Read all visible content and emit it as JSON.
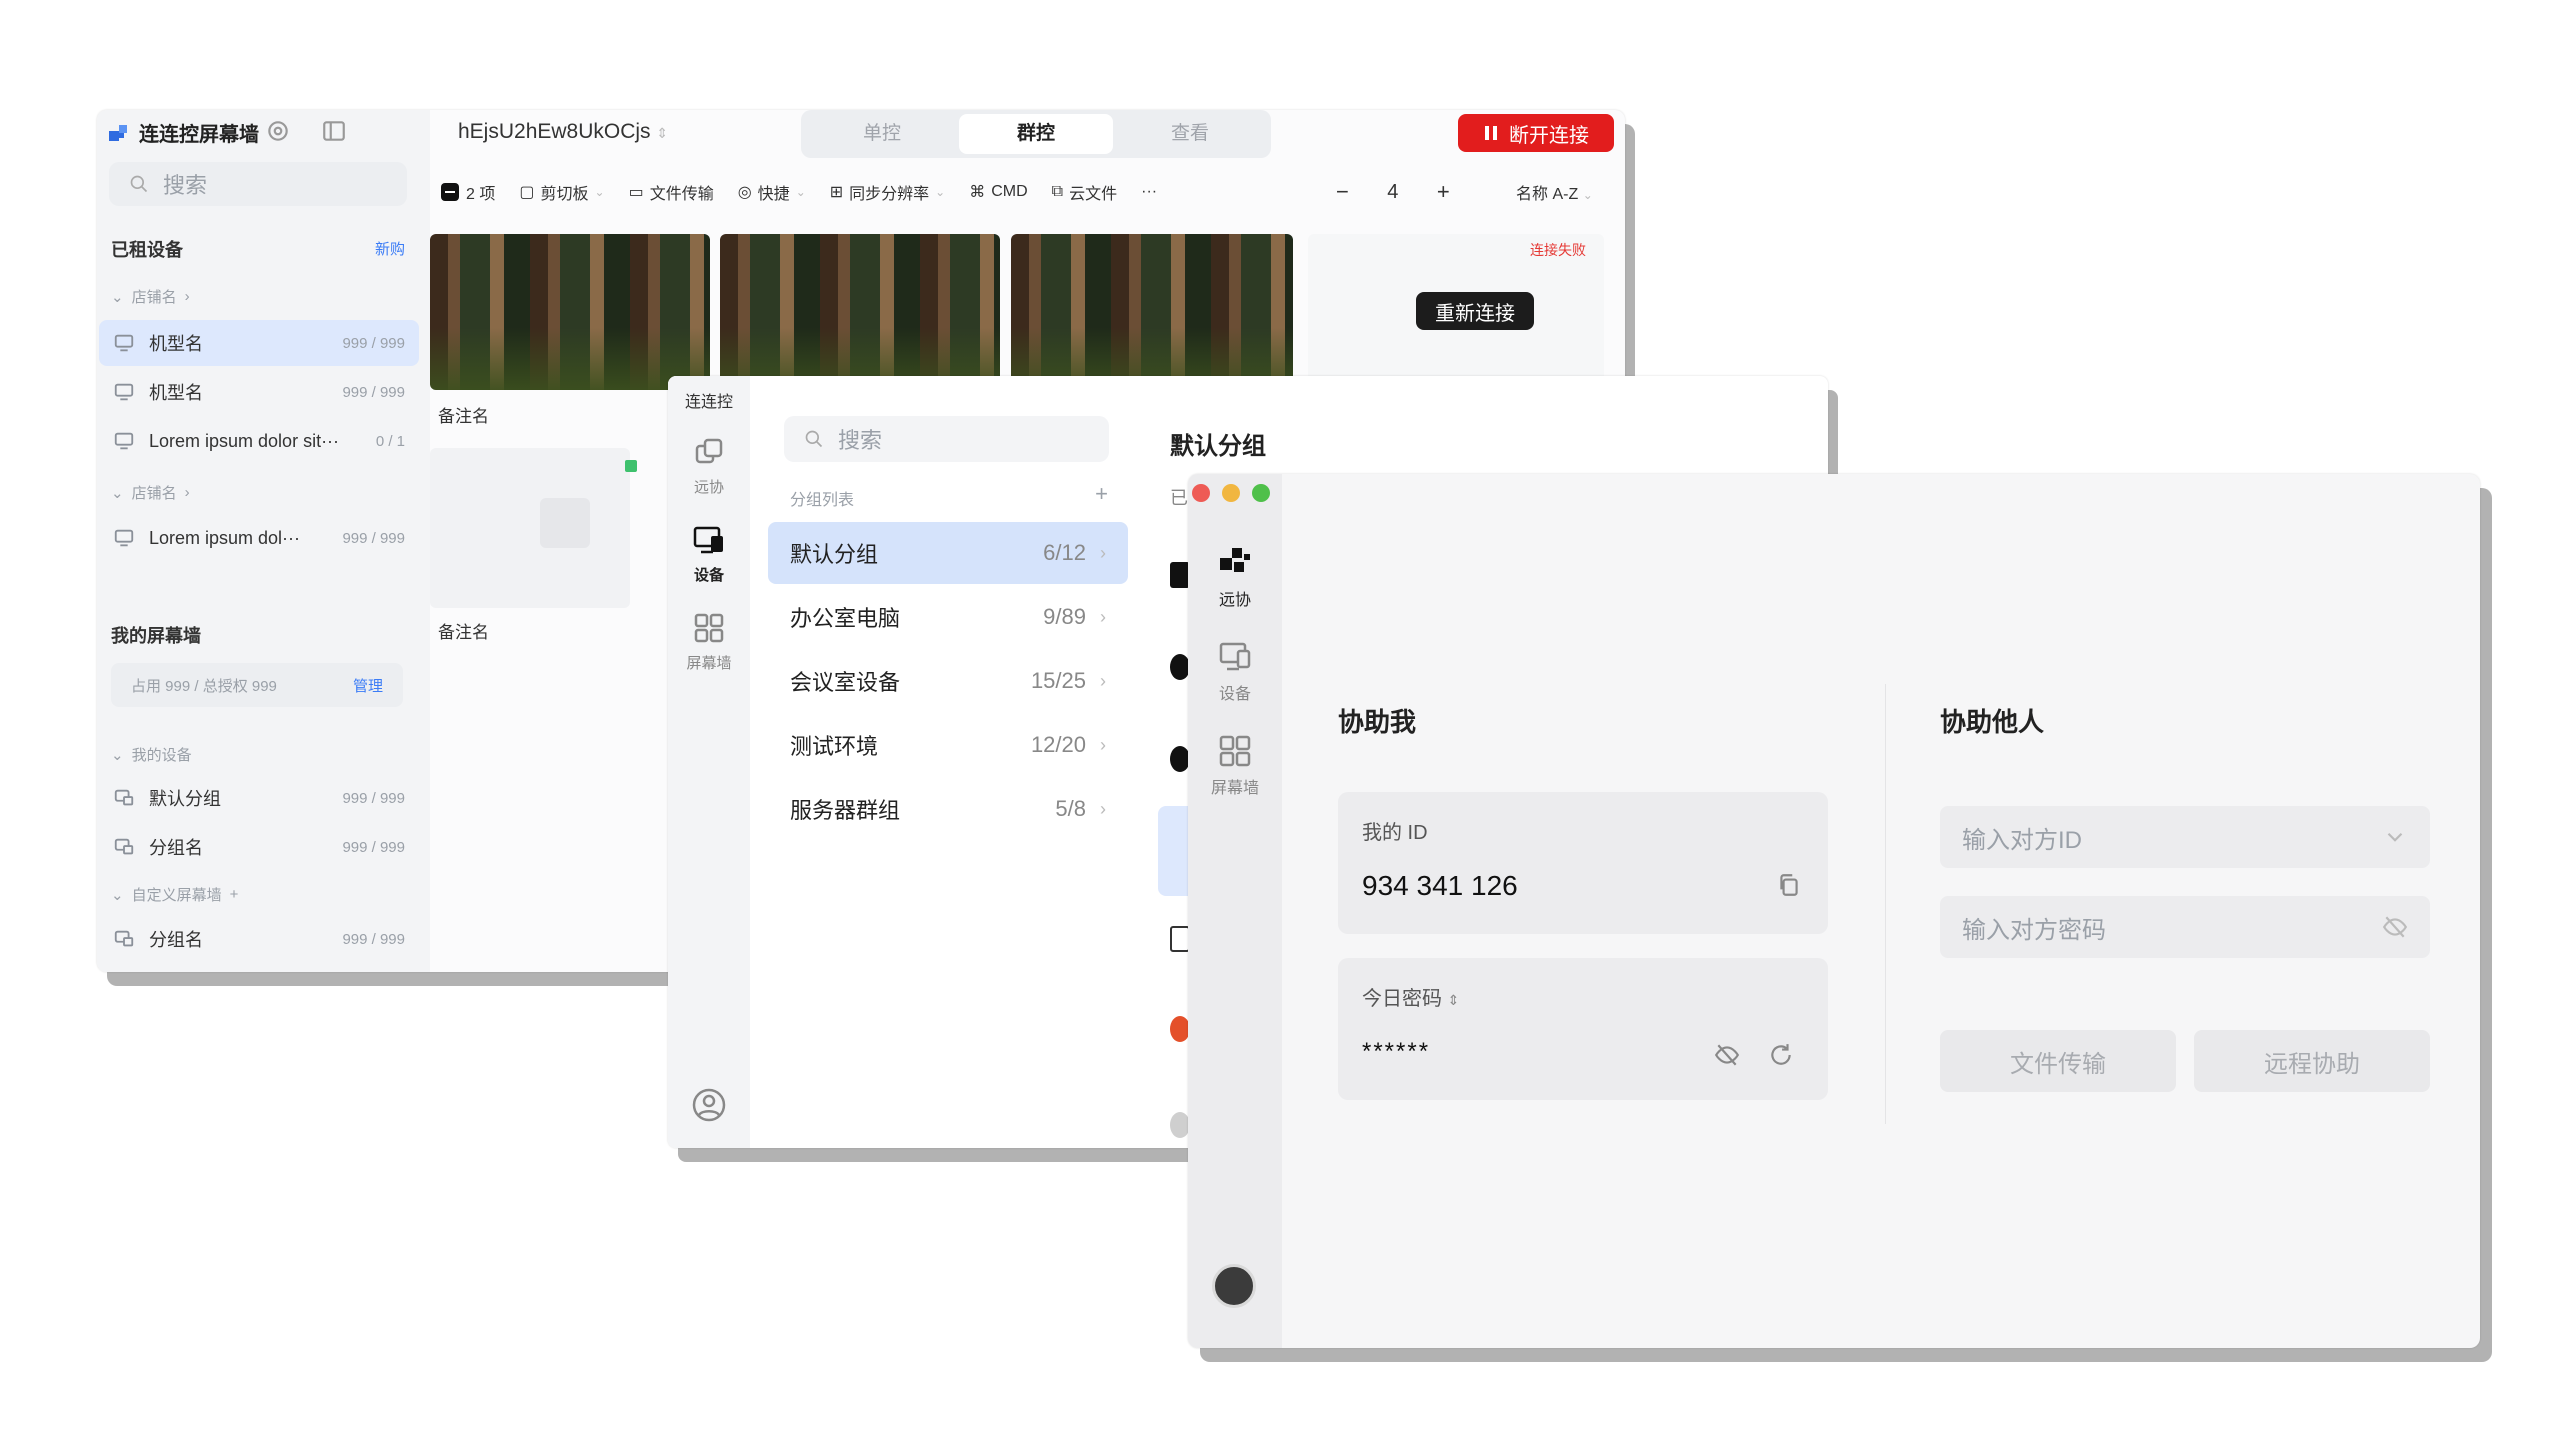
{
  "colors": {
    "accent": "#3b7cf6",
    "danger": "#e21d1d",
    "active_row": "#dde8fd",
    "group_active": "#d5e3fb"
  },
  "screen_wall": {
    "app_title": "连连控屏幕墙",
    "search_placeholder": "搜索",
    "rented_title": "已租设备",
    "buy_link": "新购",
    "store_label_1": "店铺名",
    "devices": [
      {
        "name": "机型名",
        "count": "999 / 999"
      },
      {
        "name": "机型名",
        "count": "999 / 999"
      },
      {
        "name": "Lorem ipsum dolor sit···",
        "count": "0 / 1"
      }
    ],
    "store_label_2": "店铺名",
    "device_4": {
      "name": "Lorem ipsum dol···",
      "count": "999 / 999"
    },
    "my_walls_title": "我的屏幕墙",
    "quota": "占用 999 / 总授权 999",
    "manage_link": "管理",
    "my_devices_label": "我的设备",
    "groups": [
      {
        "name": "默认分组",
        "count": "999 / 999"
      },
      {
        "name": "分组名",
        "count": "999 / 999"
      }
    ],
    "custom_walls_label": "自定义屏幕墙",
    "custom_group": {
      "name": "分组名",
      "count": "999 / 999"
    },
    "device_id": "hEjsU2hEw8UkOCjs",
    "tabs": [
      "单控",
      "群控",
      "查看"
    ],
    "disconnect_label": "断开连接",
    "toolbar": {
      "selected": "2 项",
      "clipboard": "剪切板",
      "file_transfer": "文件传输",
      "shortcut": "快捷",
      "sync_resolution": "同步分辨率",
      "cmd": "CMD",
      "cloud_file": "云文件",
      "more": "···"
    },
    "columns": "4",
    "sort_label": "名称 A-Z",
    "tile_caption_1": "备注名",
    "tile_caption_2": "备注名",
    "failed_label": "连接失败",
    "reconnect_label": "重新连接"
  },
  "group_manager": {
    "app_name": "连连控",
    "rail": [
      {
        "label": "远协",
        "icon": "remote-assist-icon"
      },
      {
        "label": "设备",
        "icon": "device-icon"
      },
      {
        "label": "屏幕墙",
        "icon": "screen-wall-icon"
      }
    ],
    "search_placeholder": "搜索",
    "list_header": "分组列表",
    "groups": [
      {
        "name": "默认分组",
        "count": "6/12"
      },
      {
        "name": "办公室电脑",
        "count": "9/89"
      },
      {
        "name": "会议室设备",
        "count": "15/25"
      },
      {
        "name": "测试环境",
        "count": "12/20"
      },
      {
        "name": "服务器群组",
        "count": "5/8"
      }
    ],
    "group_title": "默认分组",
    "partial_char": "已"
  },
  "remote_assist": {
    "rail": [
      {
        "label": "远协",
        "icon": "remote-assist-icon"
      },
      {
        "label": "设备",
        "icon": "device-icon"
      },
      {
        "label": "屏幕墙",
        "icon": "screen-wall-icon"
      }
    ],
    "help_me_title": "协助我",
    "my_id_label": "我的 ID",
    "my_id": "934 341 126",
    "today_password_label": "今日密码",
    "password": "******",
    "help_others_title": "协助他人",
    "peer_id_placeholder": "输入对方ID",
    "peer_password_placeholder": "输入对方密码",
    "file_transfer_label": "文件传输",
    "remote_assist_label": "远程协助"
  }
}
